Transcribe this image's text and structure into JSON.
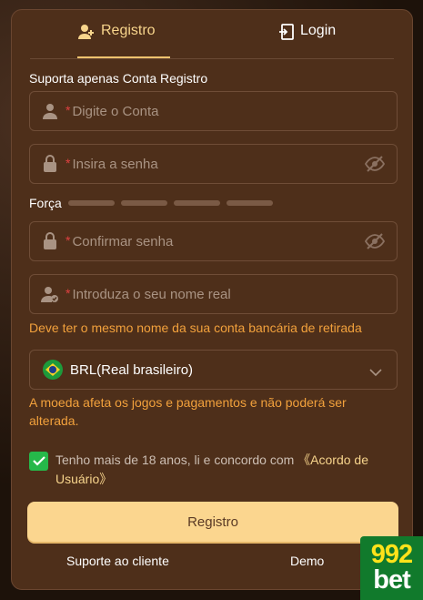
{
  "tabs": {
    "register": "Registro",
    "login": "Login"
  },
  "form": {
    "account_label": "Suporta apenas Conta Registro",
    "required_mark": "*",
    "account_placeholder": "Digite o Conta",
    "password_placeholder": "Insira a senha",
    "strength_label": "Força",
    "confirm_placeholder": "Confirmar senha",
    "realname_placeholder": "Introduza o seu nome real",
    "realname_hint": "Deve ter o mesmo nome da sua conta bancária de retirada",
    "currency_value": "BRL(Real brasileiro)",
    "currency_hint": "A moeda afeta os jogos e pagamentos e não poderá ser alterada.",
    "agree_text": "Tenho mais de 18 anos, li e concordo com ",
    "agree_link": "《Acordo de Usuário》",
    "agree_checked": true,
    "submit_label": "Registro"
  },
  "footer": {
    "support": "Suporte ao cliente",
    "demo": "Demo"
  },
  "logo": {
    "line1": "992",
    "line2": "bet"
  },
  "colors": {
    "accent": "#f8d58c",
    "warning": "#f2a13c",
    "panel": "#4e2f1a",
    "check": "#26b84a"
  }
}
